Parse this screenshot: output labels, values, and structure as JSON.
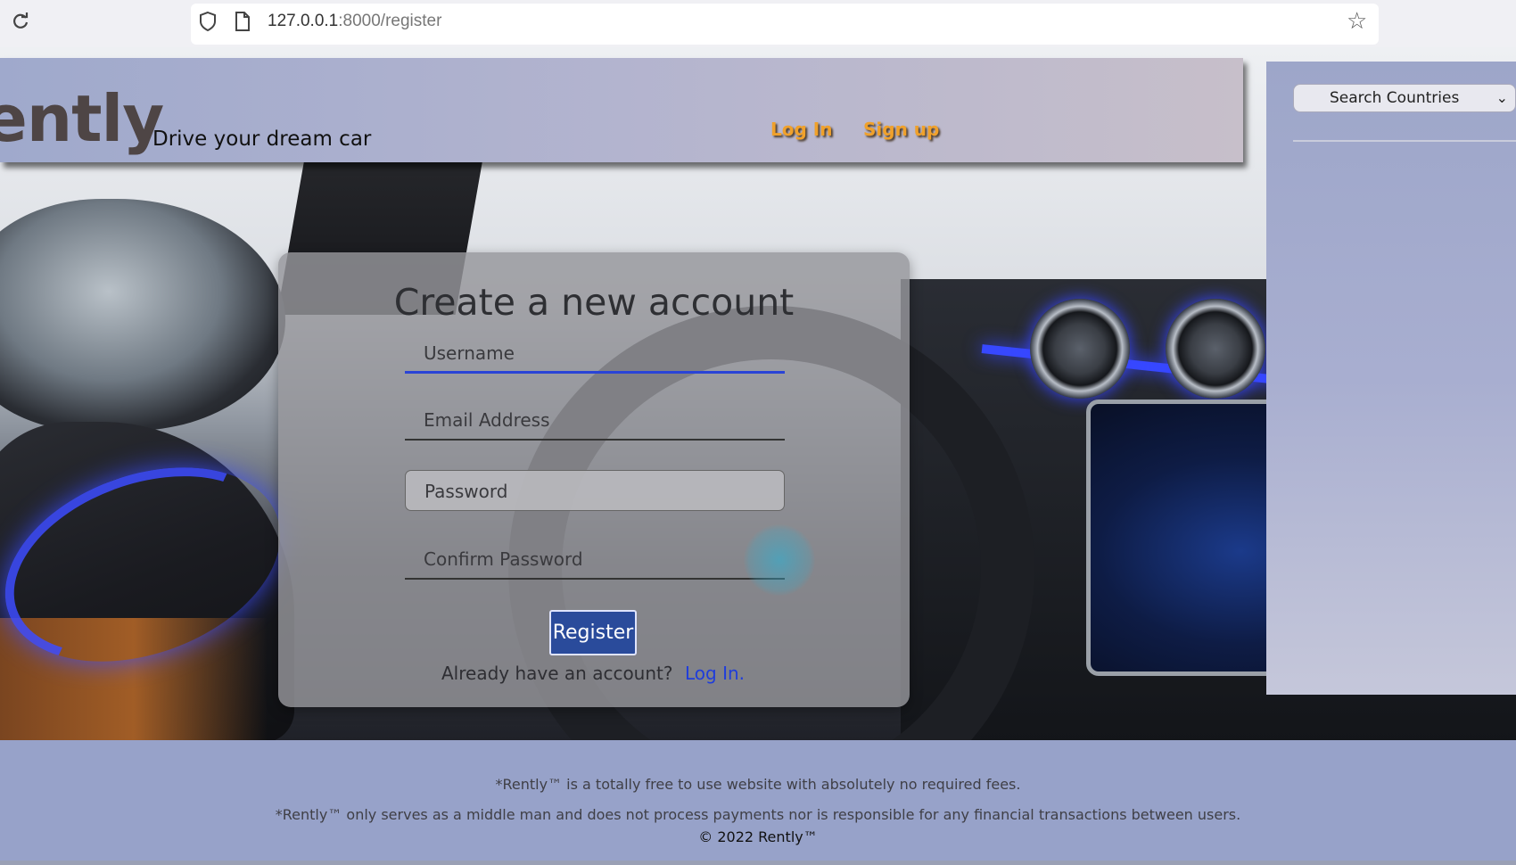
{
  "browser": {
    "url_host": "127.0.0.1",
    "url_rest": ":8000/register"
  },
  "header": {
    "brand": "ently",
    "tagline": "Drive your dream car",
    "nav": {
      "login": "Log In",
      "signup": "Sign up"
    }
  },
  "sidebar": {
    "search_select": "Search Countries"
  },
  "register_form": {
    "title": "Create a new account",
    "username_placeholder": "Username",
    "email_placeholder": "Email Address",
    "password_placeholder": "Password",
    "confirm_placeholder": "Confirm Password",
    "submit_label": "Register",
    "already_text": "Already have an account?",
    "login_link": "Log In."
  },
  "footer": {
    "line1": "*Rently™ is a totally free to use website with absolutely no required fees.",
    "line2": "*Rently™ only serves as a middle man and does not process payments nor is responsible for any financial transactions between users.",
    "copyright": "© 2022 Rently™"
  },
  "colors": {
    "accent_nav": "#f0a12b",
    "register_button": "#2a4b9b",
    "link": "#1f3ddb",
    "active_field_underline": "#2a44d6"
  }
}
